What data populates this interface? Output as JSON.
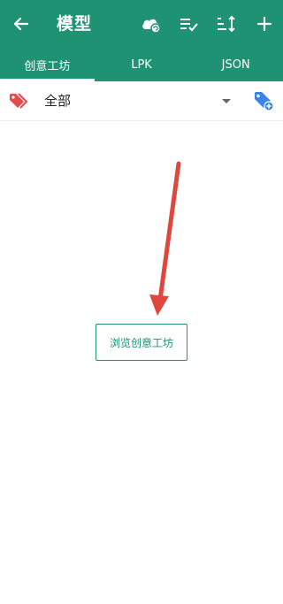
{
  "appbar": {
    "title": "模型",
    "back_icon": "arrow-left-icon",
    "cloud_icon": "cloud-sync-icon",
    "checklist_icon": "playlist-check-icon",
    "sort_icon": "sort-icon",
    "add_icon": "plus-icon"
  },
  "tabs": [
    {
      "label": "创意工坊",
      "selected": true
    },
    {
      "label": "LPK",
      "selected": false
    },
    {
      "label": "JSON",
      "selected": false
    }
  ],
  "filter": {
    "tag_icon": "tags-icon",
    "selected_value": "全部",
    "dropdown_icon": "caret-down-icon",
    "add_tag_icon": "tag-plus-icon"
  },
  "content": {
    "browse_button_label": "浏览创意工坊",
    "annotation_icon": "red-arrow-icon"
  },
  "colors": {
    "primary": "#1f9274",
    "tag_red": "#e74c4c",
    "tag_blue": "#3a86e8",
    "annotation_red": "#e0473c"
  }
}
